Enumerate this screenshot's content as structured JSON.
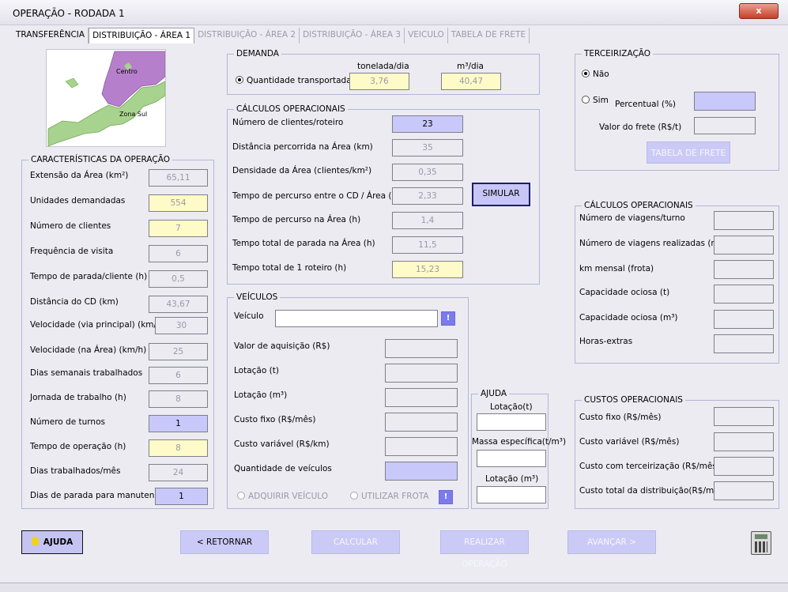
{
  "window": {
    "title": "OPERAÇÃO - RODADA 1",
    "close": "x"
  },
  "tabs": [
    {
      "label": "TRANSFERÊNCIA"
    },
    {
      "label": "DISTRIBUIÇÃO - ÁREA 1"
    },
    {
      "label": "DISTRIBUIÇÃO - ÁREA 2"
    },
    {
      "label": "DISTRIBUIÇÃO - ÁREA 3"
    },
    {
      "label": "VEICULO"
    },
    {
      "label": "TABELA DE FRETE"
    }
  ],
  "map": {
    "label_centro": "Centro",
    "label_zona_sul": "Zona Sul",
    "colors": {
      "centro": "#b67fcb",
      "zona_sul": "#a7d38e",
      "water": "#ffffff"
    }
  },
  "caracteristicas": {
    "title": "CARACTERÍSTICAS DA OPERAÇÃO",
    "rows": [
      {
        "label": "Extensão da Área (km²)",
        "value": "65,11"
      },
      {
        "label": "Unidades demandadas",
        "value": "554"
      },
      {
        "label": "Número de clientes",
        "value": "7"
      },
      {
        "label": "Frequência de visita",
        "value": "6"
      },
      {
        "label": "Tempo de parada/cliente (h)",
        "value": "0,5"
      },
      {
        "label": "Distância do CD (km)",
        "value": "43,67"
      },
      {
        "label": "Velocidade (via principal) (km/h)",
        "value": "30"
      },
      {
        "label": "Velocidade (na Área) (km/h)",
        "value": "25"
      },
      {
        "label": "Dias semanais trabalhados",
        "value": "6"
      },
      {
        "label": "Jornada de trabalho (h)",
        "value": "8"
      },
      {
        "label": "Número de turnos",
        "value": "1"
      },
      {
        "label": "Tempo de operação (h)",
        "value": "8"
      },
      {
        "label": "Dias trabalhados/mês",
        "value": "24"
      },
      {
        "label": "Dias de parada para manutenção",
        "value": "1"
      }
    ]
  },
  "demanda": {
    "title": "DEMANDA",
    "unit_ton": "tonelada/dia",
    "unit_m3": "m³/dia",
    "radio_label": "Quantidade transportada",
    "ton_value": "3,76",
    "m3_value": "40,47"
  },
  "calculos": {
    "title": "CÁLCULOS OPERACIONAIS",
    "rows": [
      {
        "label": "Número de clientes/roteiro",
        "value": "23"
      },
      {
        "label": "Distância percorrida na Área (km)",
        "value": "35"
      },
      {
        "label": "Densidade da Área (clientes/km²)",
        "value": "0,35"
      },
      {
        "label": "Tempo de percurso entre o CD / Área (h)",
        "value": "2,33"
      },
      {
        "label": "Tempo de percurso na Área  (h)",
        "value": "1,4"
      },
      {
        "label": "Tempo total de parada na Área (h)",
        "value": "11,5"
      },
      {
        "label": "Tempo total de 1 roteiro  (h)",
        "value": "15,23"
      }
    ],
    "simular_label": "SIMULAR"
  },
  "veiculos": {
    "title": "VEÍCULOS",
    "veiculo_label": "Veículo",
    "veiculo_value": "",
    "rows": [
      {
        "label": "Valor de aquisição (R$)",
        "value": ""
      },
      {
        "label": "Lotação (t)",
        "value": ""
      },
      {
        "label": "Lotação (m³)",
        "value": ""
      },
      {
        "label": "Custo fixo (R$/mês)",
        "value": ""
      },
      {
        "label": "Custo variável (R$/km)",
        "value": ""
      },
      {
        "label": "Quantidade de veículos",
        "value": ""
      }
    ],
    "radio_adquirir": "ADQUIRIR VEÍCULO",
    "radio_frota": "UTILIZAR FROTA",
    "info_btn": "!"
  },
  "ajuda_box": {
    "title": "AJUDA",
    "lotacao_t": "Lotação(t)",
    "massa": "Massa específica(t/m³)",
    "lotacao_m3": "Lotação (m³)"
  },
  "terceirizacao": {
    "title": "TERCEIRIZAÇÃO",
    "nao": "Não",
    "sim": "Sim",
    "percentual_label": "Percentual (%)",
    "valor_frete_label": "Valor do frete (R$/t)",
    "tabela_btn": "TABELA DE FRETE"
  },
  "calculos_right": {
    "title": "CÁLCULOS OPERACIONAIS",
    "rows": [
      {
        "label": "Número de viagens/turno",
        "value": ""
      },
      {
        "label": "Número de viagens realizadas (mês)",
        "value": ""
      },
      {
        "label": "km mensal (frota)",
        "value": ""
      },
      {
        "label": "Capacidade ociosa (t)",
        "value": ""
      },
      {
        "label": "Capacidade ociosa (m³)",
        "value": ""
      },
      {
        "label": "Horas-extras",
        "value": ""
      }
    ]
  },
  "custos": {
    "title": "CUSTOS OPERACIONAIS",
    "rows": [
      {
        "label": "Custo fixo (R$/mês)",
        "value": ""
      },
      {
        "label": "Custo variável (R$/mês)",
        "value": ""
      },
      {
        "label": "Custo com terceirização (R$/mês)",
        "value": ""
      },
      {
        "label": "Custo total da distribuição(R$/mês)",
        "value": ""
      }
    ]
  },
  "bottom": {
    "ajuda": "AJUDA",
    "retornar": "< RETORNAR",
    "calcular": "CALCULAR",
    "realizar": "REALIZAR OPERAÇÃO",
    "avancar": "AVANÇAR >"
  }
}
